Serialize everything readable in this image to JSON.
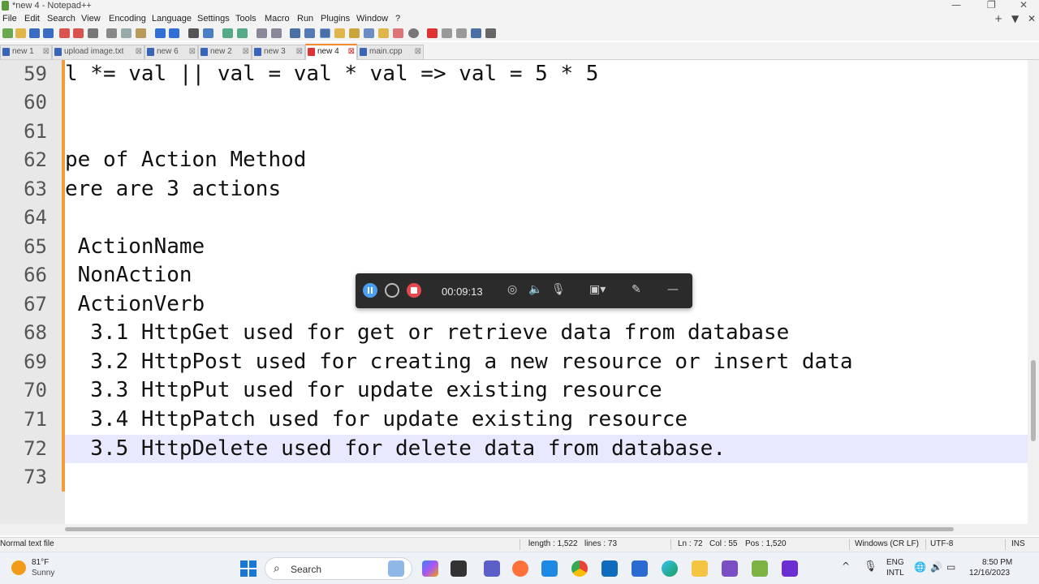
{
  "window": {
    "title": "*new 4 - Notepad++",
    "minimize_glyph": "—",
    "restore_glyph": "❐",
    "close_glyph": "✕"
  },
  "menu": {
    "items": [
      "File",
      "Edit",
      "Search",
      "View",
      "Encoding",
      "Language",
      "Settings",
      "Tools",
      "Macro",
      "Run",
      "Plugins",
      "Window",
      "?"
    ],
    "right_controls": [
      "+",
      "▼",
      "✕"
    ]
  },
  "toolbar": {
    "icons": [
      "new-file-icon",
      "open-file-icon",
      "save-icon",
      "save-all-icon",
      "close-icon",
      "close-all-icon",
      "print-icon",
      "cut-icon",
      "copy-icon",
      "paste-icon",
      "undo-icon",
      "redo-icon",
      "find-icon",
      "replace-icon",
      "zoom-in-icon",
      "zoom-out-icon",
      "sync-v-icon",
      "sync-h-icon",
      "word-wrap-icon",
      "all-chars-icon",
      "indent-guide-icon",
      "udl-icon",
      "doc-map-icon",
      "function-list-icon",
      "folder-workspace-icon",
      "monitor-icon",
      "record-macro-icon",
      "stop-macro-icon",
      "play-macro-icon",
      "run-macro-icon",
      "save-macro-icon"
    ]
  },
  "tabs": [
    {
      "label": "new 1",
      "active": false
    },
    {
      "label": "upload image.txt",
      "active": false
    },
    {
      "label": "new 6",
      "active": false
    },
    {
      "label": "new 2",
      "active": false
    },
    {
      "label": "new 3",
      "active": false
    },
    {
      "label": "new 4",
      "active": true
    },
    {
      "label": "main.cpp",
      "active": false
    }
  ],
  "editor": {
    "current_line": 72,
    "lines": [
      {
        "num": "59",
        "text": "l *= val || val = val * val => val = 5 * 5"
      },
      {
        "num": "60",
        "text": ""
      },
      {
        "num": "61",
        "text": ""
      },
      {
        "num": "62",
        "text": "pe of Action Method"
      },
      {
        "num": "63",
        "text": "ere are 3 actions"
      },
      {
        "num": "64",
        "text": ""
      },
      {
        "num": "65",
        "text": " ActionName"
      },
      {
        "num": "66",
        "text": " NonAction"
      },
      {
        "num": "67",
        "text": " ActionVerb"
      },
      {
        "num": "68",
        "text": "  3.1 HttpGet used for get or retrieve data from database"
      },
      {
        "num": "69",
        "text": "  3.2 HttpPost used for creating a new resource or insert data"
      },
      {
        "num": "70",
        "text": "  3.3 HttpPut used for update existing resource"
      },
      {
        "num": "71",
        "text": "  3.4 HttpPatch used for update existing resource"
      },
      {
        "num": "72",
        "text": "  3.5 HttpDelete used for delete data from database."
      },
      {
        "num": "73",
        "text": ""
      }
    ]
  },
  "recorder": {
    "timer": "00:09:13",
    "icons": [
      "pause-icon",
      "restart-icon",
      "stop-icon",
      "webcam-icon",
      "speaker-icon",
      "microphone-icon",
      "screenshot-icon",
      "pen-icon",
      "minimize-icon"
    ]
  },
  "statusbar": {
    "file_type": "Normal text file",
    "length": "length : 1,522",
    "lines": "lines : 73",
    "ln": "Ln : 72",
    "col": "Col : 55",
    "pos": "Pos : 1,520",
    "eol": "Windows (CR LF)",
    "encoding": "UTF-8",
    "mode": "INS"
  },
  "taskbar": {
    "weather_temp": "81°F",
    "weather_condition": "Sunny",
    "search_label": "Search",
    "language_line1": "ENG",
    "language_line2": "INTL",
    "time": "8:50 PM",
    "date": "12/16/2023",
    "apps": [
      "file-explorer-icon",
      "copilot-icon",
      "terminal-icon",
      "teams-icon",
      "firefox-icon",
      "vscode-icon",
      "chrome-icon",
      "mail-icon",
      "store-icon",
      "edge-icon",
      "folder-icon",
      "visual-studio-icon",
      "notepad-plus-plus-icon",
      "clipchamp-icon"
    ]
  },
  "colors": {
    "fold_margin": "#f39c3c",
    "current_line_highlight": "#e8e8ff",
    "recorder_bg": "#2b2b2b",
    "active_tab_accent": "#f38b2c"
  }
}
